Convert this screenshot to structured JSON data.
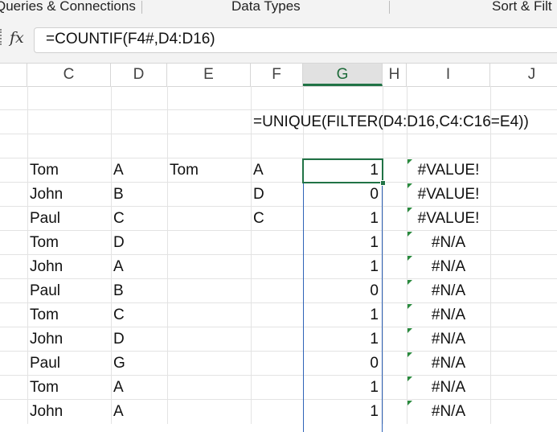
{
  "ribbon": {
    "group1": "Queries & Connections",
    "group2": "Data Types",
    "group3": "Sort & Filt"
  },
  "formula_bar": {
    "fx_icon": "fx",
    "formula": "=COUNTIF(F4#,D4:D16)"
  },
  "columns": [
    "C",
    "D",
    "E",
    "F",
    "G",
    "H",
    "I",
    "J"
  ],
  "selected_column": "G",
  "note_formula": "=UNIQUE(FILTER(D4:D16,C4:C16=E4))",
  "rows": [
    {
      "c": "Tom",
      "d": "A",
      "e": "Tom",
      "f": "A",
      "g": "1",
      "i": "#VALUE!"
    },
    {
      "c": "John",
      "d": "B",
      "e": "",
      "f": "D",
      "g": "0",
      "i": "#VALUE!"
    },
    {
      "c": "Paul",
      "d": "C",
      "e": "",
      "f": "C",
      "g": "1",
      "i": "#VALUE!"
    },
    {
      "c": "Tom",
      "d": "D",
      "e": "",
      "f": "",
      "g": "1",
      "i": "#N/A"
    },
    {
      "c": "John",
      "d": "A",
      "e": "",
      "f": "",
      "g": "1",
      "i": "#N/A"
    },
    {
      "c": "Paul",
      "d": "B",
      "e": "",
      "f": "",
      "g": "0",
      "i": "#N/A"
    },
    {
      "c": "Tom",
      "d": "C",
      "e": "",
      "f": "",
      "g": "1",
      "i": "#N/A"
    },
    {
      "c": "John",
      "d": "D",
      "e": "",
      "f": "",
      "g": "1",
      "i": "#N/A"
    },
    {
      "c": "Paul",
      "d": "G",
      "e": "",
      "f": "",
      "g": "0",
      "i": "#N/A"
    },
    {
      "c": "Tom",
      "d": "A",
      "e": "",
      "f": "",
      "g": "1",
      "i": "#N/A"
    },
    {
      "c": "John",
      "d": "A",
      "e": "",
      "f": "",
      "g": "1",
      "i": "#N/A"
    }
  ],
  "colors": {
    "selection": "#217346",
    "spill_border": "#2f63b8",
    "error_triangle": "#2a8a3e"
  }
}
